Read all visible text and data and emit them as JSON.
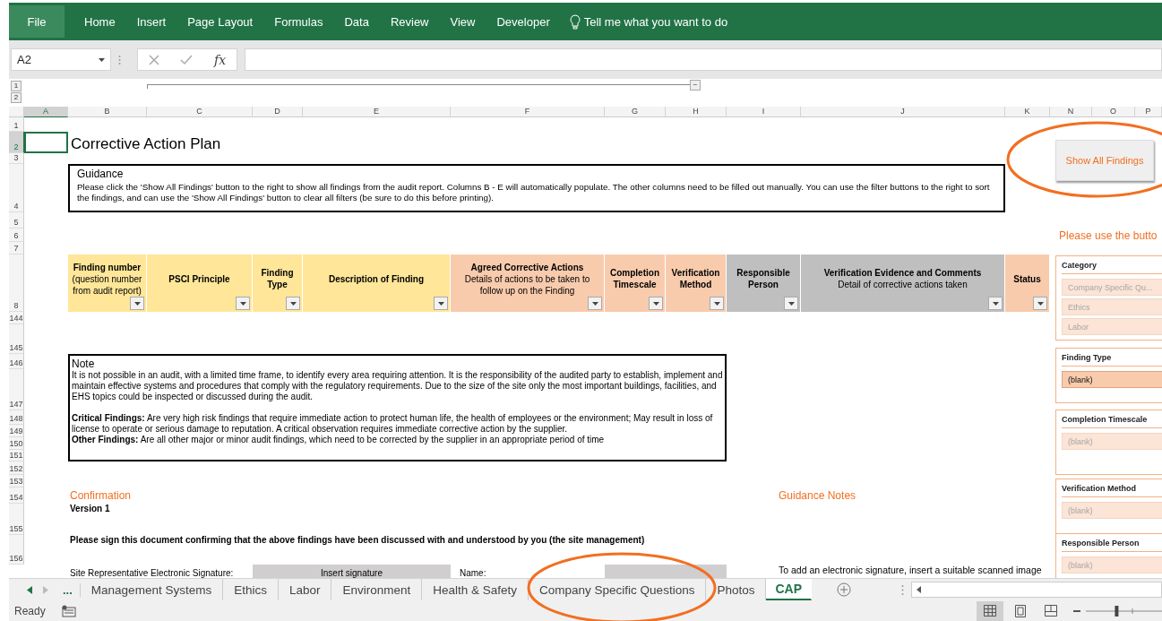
{
  "ribbon": {
    "file_button": "File",
    "tabs": [
      {
        "label": "Home"
      },
      {
        "label": "Insert"
      },
      {
        "label": "Page Layout"
      },
      {
        "label": "Formulas"
      },
      {
        "label": "Data"
      },
      {
        "label": "Review"
      },
      {
        "label": "View"
      },
      {
        "label": "Developer"
      }
    ],
    "tell_me": "Tell me what you want to do"
  },
  "formula_bar": {
    "name_box": "A2",
    "fx": "fx"
  },
  "outline": {
    "levels": [
      "1",
      "2"
    ],
    "collapse": "−"
  },
  "columns": [
    {
      "label": "A",
      "selected": true
    },
    {
      "label": "B",
      "selected": false
    },
    {
      "label": "C",
      "selected": false
    },
    {
      "label": "D",
      "selected": false
    },
    {
      "label": "E",
      "selected": false
    },
    {
      "label": "F",
      "selected": false
    },
    {
      "label": "G",
      "selected": false
    },
    {
      "label": "H",
      "selected": false
    },
    {
      "label": "I",
      "selected": false
    },
    {
      "label": "J",
      "selected": false
    },
    {
      "label": "K",
      "selected": false
    },
    {
      "label": "N",
      "selected": false
    },
    {
      "label": "O",
      "selected": false
    },
    {
      "label": "P",
      "selected": false
    }
  ],
  "rows": [
    {
      "label": "1",
      "selected": false
    },
    {
      "label": "2",
      "selected": true
    },
    {
      "label": "3",
      "selected": false
    },
    {
      "label": "4",
      "selected": false
    },
    {
      "label": "5",
      "selected": false
    },
    {
      "label": "6",
      "selected": false
    },
    {
      "label": "7",
      "selected": false
    },
    {
      "label": "8",
      "selected": false
    },
    {
      "label": "144",
      "selected": false
    },
    {
      "label": "145",
      "selected": false
    },
    {
      "label": "146",
      "selected": false
    },
    {
      "label": "147",
      "selected": false
    },
    {
      "label": "148",
      "selected": false
    },
    {
      "label": "149",
      "selected": false
    },
    {
      "label": "150",
      "selected": false
    },
    {
      "label": "151",
      "selected": false
    },
    {
      "label": "152",
      "selected": false
    },
    {
      "label": "153",
      "selected": false
    },
    {
      "label": "154",
      "selected": false
    },
    {
      "label": "155",
      "selected": false
    },
    {
      "label": "156",
      "selected": false
    }
  ],
  "sheet": {
    "title": "Corrective Action Plan",
    "guidance": {
      "title": "Guidance",
      "text": "Please click the 'Show All Findings' button to the right to show all findings from the audit report. Columns B - E will automatically populate. The other columns need to be filled out manually. You can use the filter buttons to the right to sort the findings, and can use the 'Show All Findings' button to clear all filters (be sure to do this before printing)."
    },
    "show_all_button": "Show All Findings",
    "slicer_prompt": "Please use the butto",
    "table_headers": [
      {
        "title": "Finding number",
        "subtitle": "(question number from audit report)",
        "color": "#ffe699"
      },
      {
        "title": "PSCI Principle",
        "color": "#ffe699"
      },
      {
        "title": "Finding Type",
        "color": "#ffe699"
      },
      {
        "title": "Description of Finding",
        "color": "#ffe699"
      },
      {
        "title": "Agreed Corrective Actions",
        "subtitle": "Details of actions to be taken to follow up on the Finding",
        "color": "#f8cbad"
      },
      {
        "title": "Completion Timescale",
        "color": "#f8cbad"
      },
      {
        "title": "Verification Method",
        "color": "#f8cbad"
      },
      {
        "title": "Responsible Person",
        "color": "#bfbfbf"
      },
      {
        "title": "Verification Evidence and Comments",
        "subtitle": "Detail of corrective actions taken",
        "color": "#bfbfbf"
      },
      {
        "title": "Status",
        "color": "#f8cbad"
      }
    ],
    "note": {
      "title": "Note",
      "paragraphs": [
        "It is not possible in an audit, with a limited time frame, to identify every area requiring attention. It is the responsibility of the audited party to establish, implement and maintain effective systems and procedures that comply with the  regulatory requirements.  Due to the size of the site only the most important buildings, facilities, and EHS topics could be inspected or discussed during the audit.",
        "**Critical Findings:** Are very high risk findings that require immediate action to protect human life, the health of employees or the environment; May result in loss of license to operate or serious damage to reputation. A critical observation requires immediate corrective action by the supplier.",
        "**Other Findings:** Are all other major or minor audit findings, which need to be corrected by the supplier in an appropriate period of time"
      ]
    },
    "confirmation": {
      "heading": "Confirmation",
      "version": "Version 1",
      "instruction": "Please sign this document confirming that the above findings have been discussed with and understood by you (the site management)",
      "signature_label": "Site Representative Electronic Signature:",
      "signature_field": "Insert signature",
      "name_label": "Name:"
    },
    "guidance_notes": {
      "heading": "Guidance Notes",
      "text": "To add an electronic signature, insert a suitable scanned image"
    },
    "slicers": [
      {
        "title": "Category",
        "items": [
          {
            "label": "Company Specific Qu...",
            "selected": false
          },
          {
            "label": "Ethics",
            "selected": false
          },
          {
            "label": "Labor",
            "selected": false
          }
        ]
      },
      {
        "title": "Finding Type",
        "items": [
          {
            "label": "(blank)",
            "selected": true
          }
        ]
      },
      {
        "title": "Completion Timescale",
        "items": [
          {
            "label": "(blank)",
            "selected": false
          }
        ]
      },
      {
        "title": "Verification Method",
        "items": [
          {
            "label": "(blank)",
            "selected": false
          }
        ]
      },
      {
        "title": "Responsible Person",
        "items": [
          {
            "label": "(blank)",
            "selected": false
          }
        ]
      }
    ]
  },
  "sheet_tabs": {
    "overflow": "...",
    "tabs": [
      {
        "label": "Management Systems",
        "selected": false
      },
      {
        "label": "Ethics",
        "selected": false
      },
      {
        "label": "Labor",
        "selected": false
      },
      {
        "label": "Environment",
        "selected": false
      },
      {
        "label": "Health & Safety",
        "selected": false
      },
      {
        "label": "Company Specific Questions",
        "selected": false
      },
      {
        "label": "Photos",
        "selected": false
      },
      {
        "label": "CAP",
        "selected": true
      }
    ]
  },
  "status_bar": {
    "status": "Ready",
    "zoom": {
      "level": 0.4
    }
  }
}
